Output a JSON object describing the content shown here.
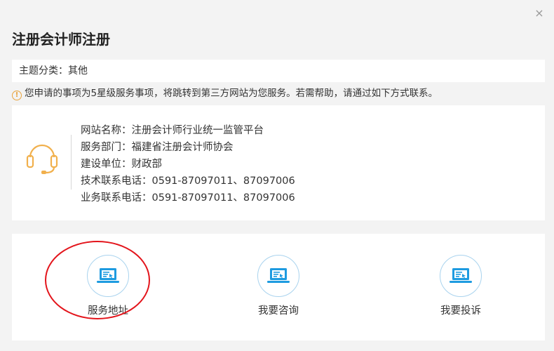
{
  "dialog": {
    "title": "注册会计师注册",
    "close_glyph": "×"
  },
  "topic": {
    "text": "主题分类：其他"
  },
  "notice": {
    "icon": "info-circle-icon",
    "icon_glyph": "!",
    "text": "您申请的事项为5星级服务事项，将跳转到第三方网站为您服务。若需帮助，请通过如下方式联系。"
  },
  "contact": {
    "icon": "headset-icon",
    "lines": [
      "网站名称：注册会计师行业统一监管平台",
      "服务部门：福建省注册会计师协会",
      "建设单位：财政部",
      "技术联系电话：0591-87097011、87097006",
      "业务联系电话：0591-87097011、87097006"
    ]
  },
  "actions": [
    {
      "label": "服务地址",
      "icon": "laptop-icon"
    },
    {
      "label": "我要咨询",
      "icon": "laptop-icon"
    },
    {
      "label": "我要投诉",
      "icon": "laptop-icon"
    }
  ],
  "colors": {
    "accent_blue": "#1e9be0",
    "warning_orange": "#e8a33d",
    "headset_orange": "#f1b04c",
    "annotation_red": "#e3141b"
  }
}
